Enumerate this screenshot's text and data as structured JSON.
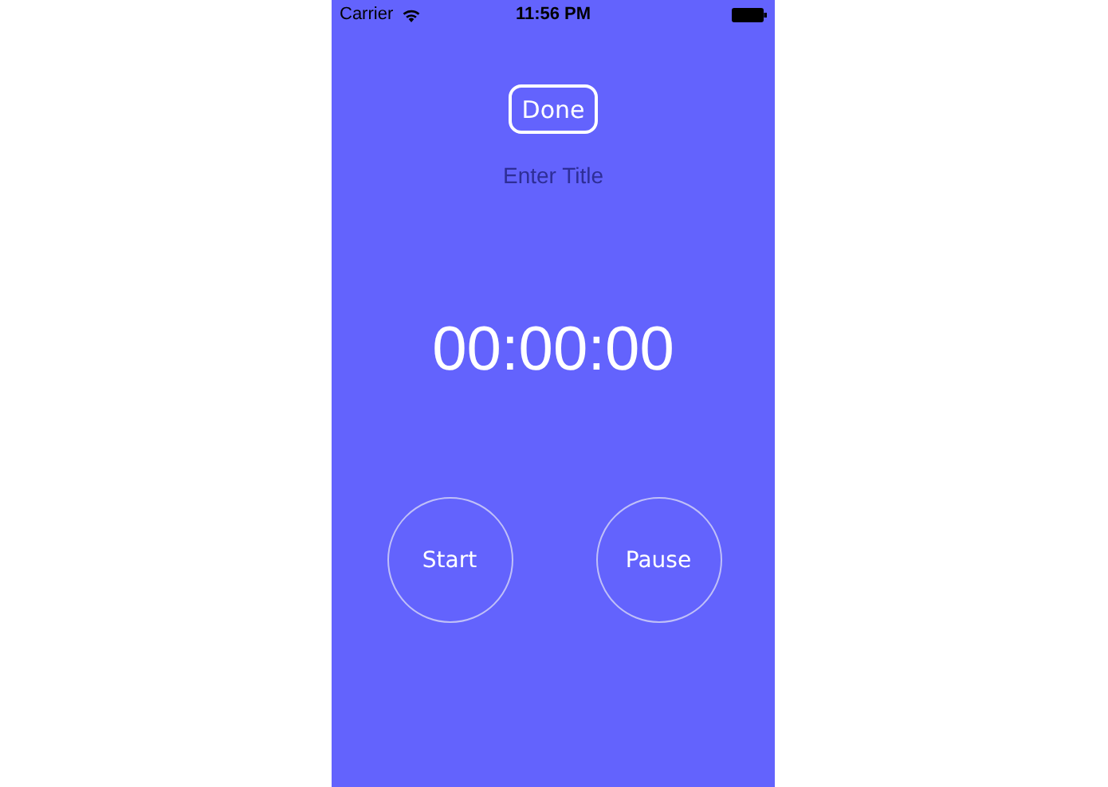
{
  "status_bar": {
    "carrier": "Carrier",
    "time": "11:56 PM"
  },
  "done_button": "Done",
  "title_field": {
    "placeholder": "Enter Title"
  },
  "timer": "00:00:00",
  "buttons": [
    {
      "label": "Start"
    },
    {
      "label": "Pause"
    }
  ]
}
